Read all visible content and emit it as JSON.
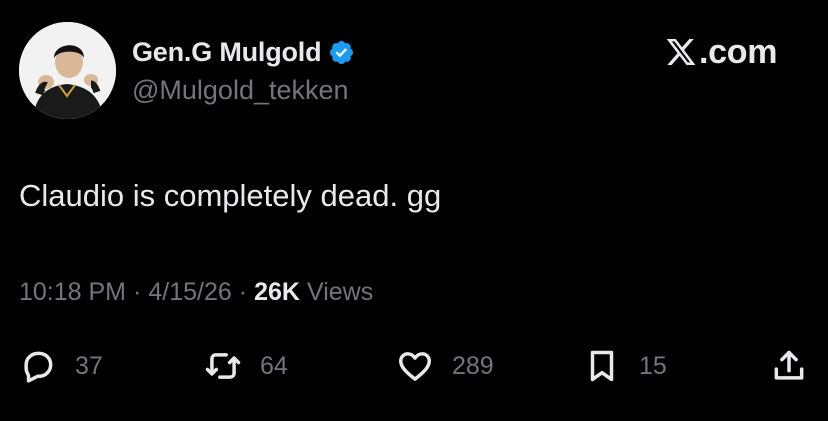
{
  "author": {
    "display_name": "Gen.G Mulgold",
    "handle": "@Mulgold_tekken",
    "verified": true,
    "avatar_icon": "profile-photo"
  },
  "brand": {
    "label": ".com",
    "icon": "x-logo-icon"
  },
  "tweet": {
    "text": "Claudio is completely dead. gg"
  },
  "meta": {
    "time": "10:18 PM",
    "separator": "·",
    "date": "4/15/26",
    "views_count": "26K",
    "views_label": "Views"
  },
  "actions": {
    "replies": "37",
    "reposts": "64",
    "likes": "289",
    "bookmarks": "15"
  },
  "colors": {
    "background": "#000000",
    "primary_text": "#e7e9ea",
    "secondary_text": "#71767b",
    "verified_blue": "#1d9bf0"
  }
}
